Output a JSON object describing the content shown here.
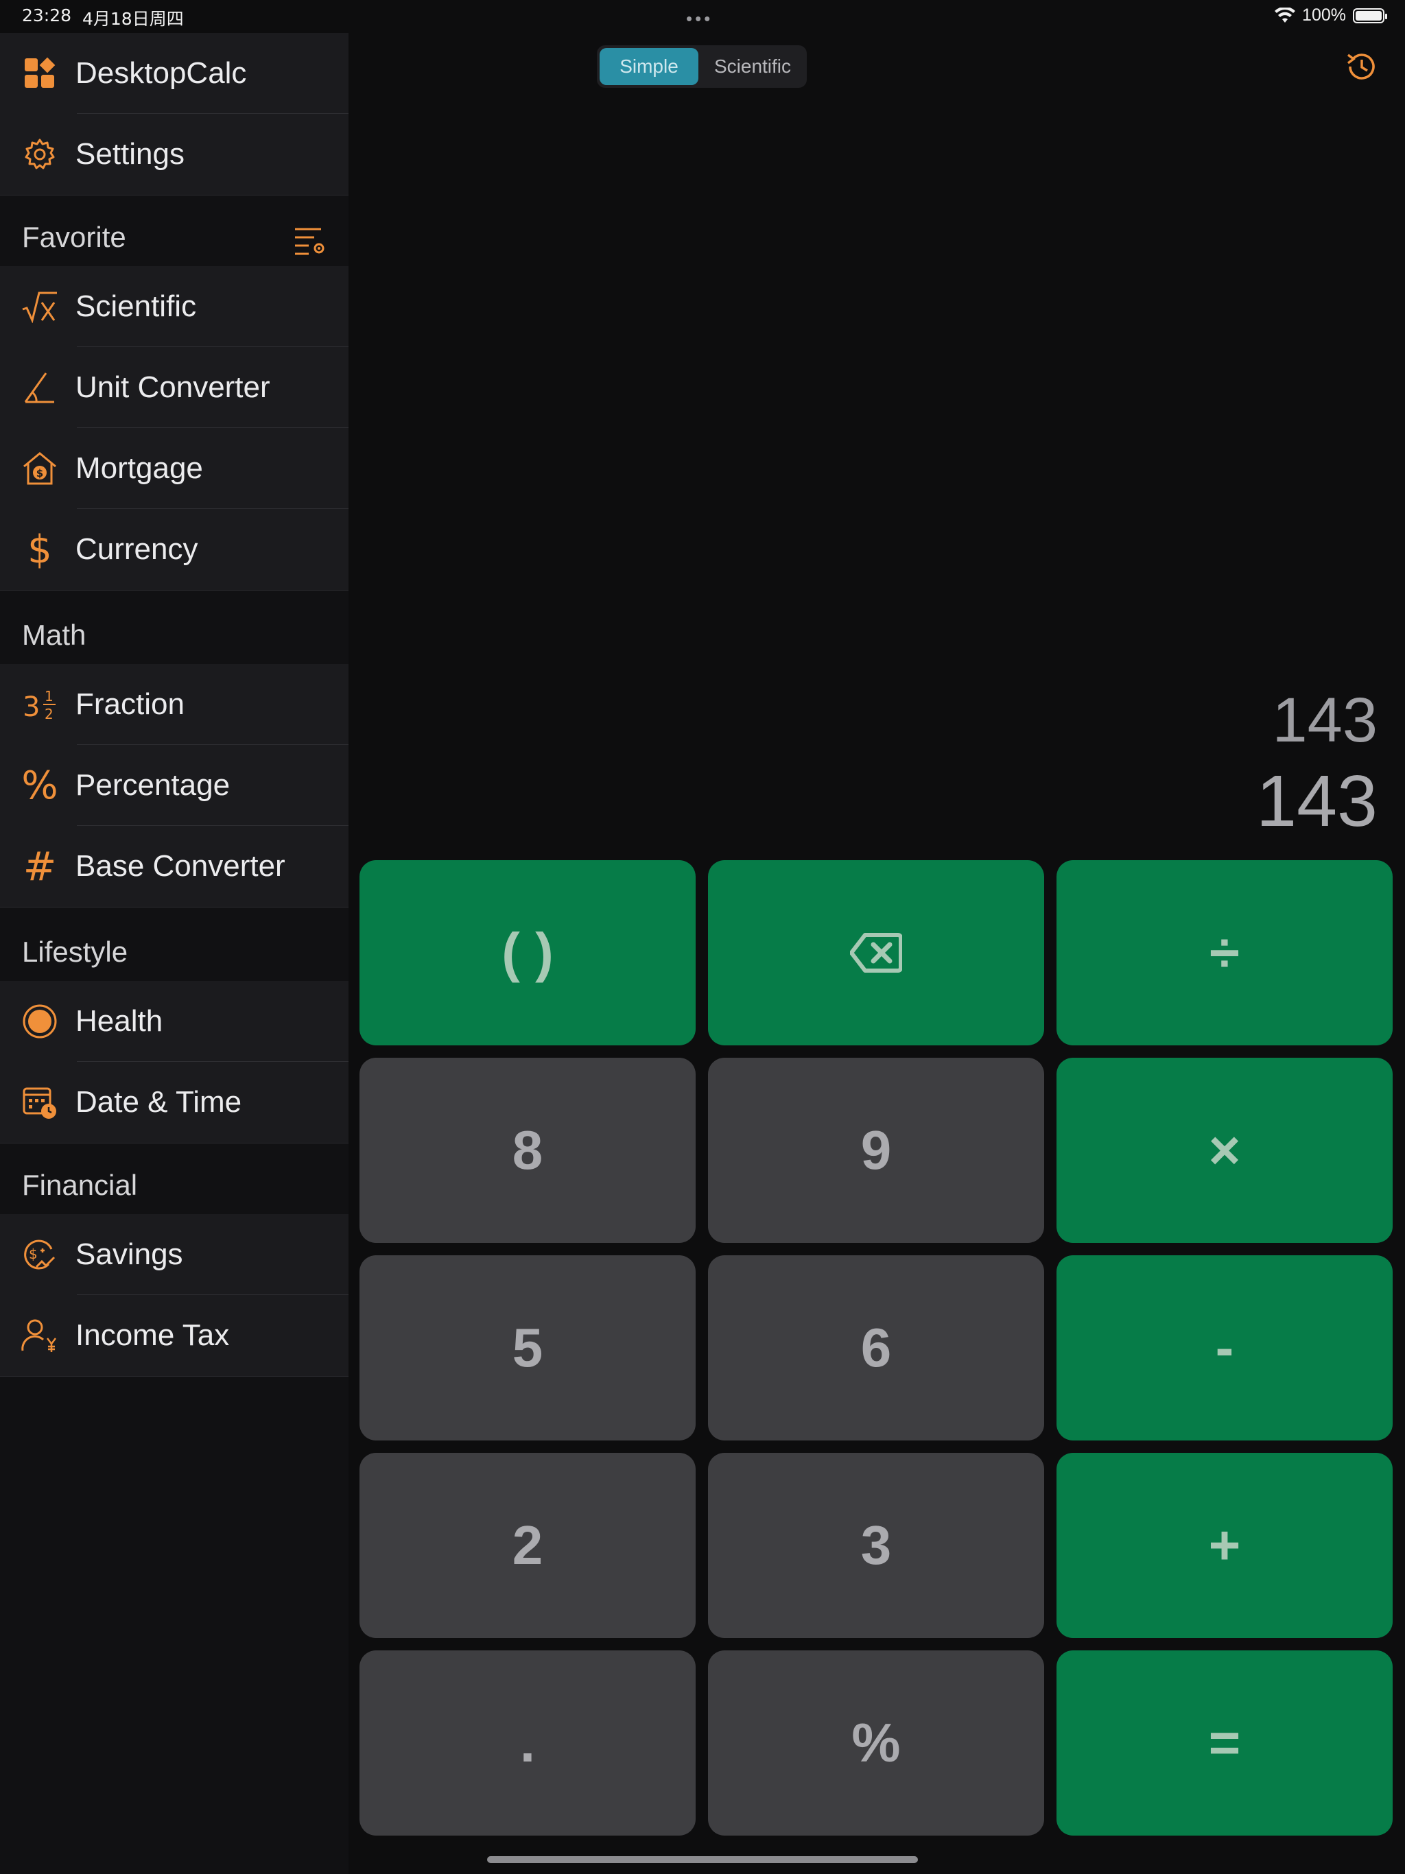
{
  "status": {
    "time": "23:28",
    "date": "4月18日周四",
    "battery": "100%"
  },
  "sidebar": {
    "top_items": [
      {
        "label": "DesktopCalc",
        "icon": "widgets-icon"
      },
      {
        "label": "Settings",
        "icon": "gear-icon"
      }
    ],
    "sections": [
      {
        "title": "Favorite",
        "items": [
          {
            "label": "Scientific",
            "icon": "square-root-icon"
          },
          {
            "label": "Unit Converter",
            "icon": "angle-icon"
          },
          {
            "label": "Mortgage",
            "icon": "house-dollar-icon"
          },
          {
            "label": "Currency",
            "icon": "dollar-icon"
          }
        ]
      },
      {
        "title": "Math",
        "items": [
          {
            "label": "Fraction",
            "icon": "fraction-icon"
          },
          {
            "label": "Percentage",
            "icon": "percent-icon"
          },
          {
            "label": "Base Converter",
            "icon": "hash-icon"
          }
        ]
      },
      {
        "title": "Lifestyle",
        "items": [
          {
            "label": "Health",
            "icon": "bmi-icon"
          },
          {
            "label": "Date & Time",
            "icon": "calendar-clock-icon"
          }
        ]
      },
      {
        "title": "Financial",
        "items": [
          {
            "label": "Savings",
            "icon": "savings-icon"
          },
          {
            "label": "Income Tax",
            "icon": "person-yen-icon"
          }
        ]
      }
    ]
  },
  "mode": {
    "simple": "Simple",
    "scientific": "Scientific",
    "selected": "Simple"
  },
  "display": {
    "expression": "143",
    "result": "143"
  },
  "keypad": [
    [
      "( )",
      "backspace",
      "÷"
    ],
    [
      "8",
      "9",
      "×"
    ],
    [
      "5",
      "6",
      "-"
    ],
    [
      "2",
      "3",
      "+"
    ],
    [
      ".",
      "%",
      "="
    ]
  ],
  "colors": {
    "accent": "#f0903a",
    "operator_key": "#067c48",
    "number_key": "#3e3e41",
    "segment_selected": "#2a8fa5"
  }
}
